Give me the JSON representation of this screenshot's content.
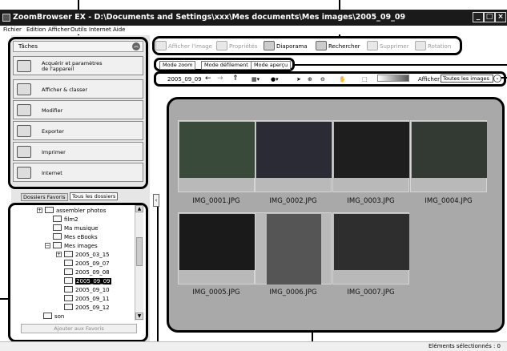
{
  "window": {
    "title": "ZoomBrowser EX - D:\\Documents and Settings\\xxx\\Mes documents\\Mes images\\2005_09_09"
  },
  "menu": [
    "Fichier",
    "Edition",
    "Afficher",
    "Outils",
    "Internet",
    "Aide"
  ],
  "tasks": {
    "header": "Tâches",
    "items": [
      {
        "label_line1": "Acquérir et paramètres",
        "label_line2": "de l'appareil",
        "icon": "camera-icon"
      },
      {
        "label_line1": "Afficher & classer",
        "label_line2": "",
        "icon": "folder-icon"
      },
      {
        "label_line1": "Modifier",
        "label_line2": "",
        "icon": "edit-icon"
      },
      {
        "label_line1": "Exporter",
        "label_line2": "",
        "icon": "export-icon"
      },
      {
        "label_line1": "Imprimer",
        "label_line2": "",
        "icon": "printer-icon"
      },
      {
        "label_line1": "Internet",
        "label_line2": "",
        "icon": "globe-icon"
      }
    ]
  },
  "folder_tabs": {
    "favorites": "Dossiers Favoris",
    "all": "Tous les dossiers"
  },
  "tree": [
    {
      "label": "assembler photos",
      "level": 2,
      "expandable": true
    },
    {
      "label": "film2",
      "level": 2,
      "expandable": false
    },
    {
      "label": "Ma musique",
      "level": 2,
      "expandable": false
    },
    {
      "label": "Mes eBooks",
      "level": 2,
      "expandable": false
    },
    {
      "label": "Mes images",
      "level": 2,
      "expandable": true,
      "expanded": true
    },
    {
      "label": "2005_03_15",
      "level": 3,
      "expandable": true
    },
    {
      "label": "2005_09_07",
      "level": 3,
      "expandable": false
    },
    {
      "label": "2005_09_08",
      "level": 3,
      "expandable": false
    },
    {
      "label": "2005_09_09",
      "level": 3,
      "expandable": false,
      "selected": true
    },
    {
      "label": "2005_09_10",
      "level": 3,
      "expandable": false
    },
    {
      "label": "2005_09_11",
      "level": 3,
      "expandable": false
    },
    {
      "label": "2005_09_12",
      "level": 3,
      "expandable": false
    },
    {
      "label": "son",
      "level": 1,
      "expandable": false
    }
  ],
  "add_favorites": "Ajouter aux Favoris",
  "toolbar": {
    "view_image": "Afficher l'image",
    "properties": "Propriétés",
    "slideshow": "Diaporama",
    "search": "Rechercher",
    "delete": "Supprimer",
    "rotate": "Rotation"
  },
  "modes": [
    "Mode zoom",
    "Mode défilement",
    "Mode aperçu"
  ],
  "nav": {
    "folder": "2005_09_09",
    "show_label": "Afficher",
    "show_value": "Toutes les images"
  },
  "thumbnails": [
    {
      "name": "IMG_0001.JPG",
      "color": "#3a4a3a"
    },
    {
      "name": "IMG_0002.JPG",
      "color": "#2b2b36"
    },
    {
      "name": "IMG_0003.JPG",
      "color": "#1e1e1e"
    },
    {
      "name": "IMG_0004.JPG",
      "color": "#333a33"
    },
    {
      "name": "IMG_0005.JPG",
      "color": "#1a1a1a"
    },
    {
      "name": "IMG_0006.JPG",
      "color": "#555555"
    },
    {
      "name": "IMG_0007.JPG",
      "color": "#2e2e2e"
    }
  ],
  "status": "Eléments sélectionnés : 0"
}
